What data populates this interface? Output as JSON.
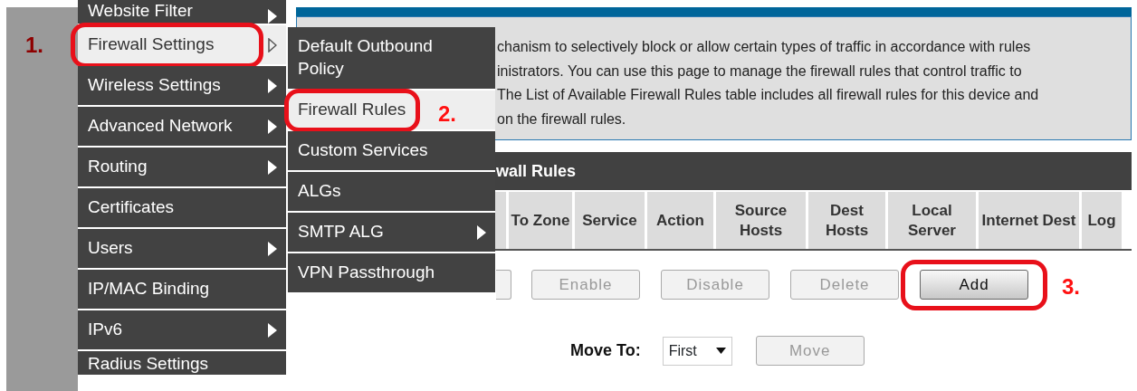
{
  "menu": {
    "items": [
      {
        "label": "Website Filter",
        "submenu": true,
        "selected": false
      },
      {
        "label": "Firewall Settings",
        "submenu": true,
        "selected": true,
        "callout": "1."
      },
      {
        "label": "Wireless Settings",
        "submenu": true,
        "selected": false
      },
      {
        "label": "Advanced Network",
        "submenu": true,
        "selected": false
      },
      {
        "label": "Routing",
        "submenu": true,
        "selected": false
      },
      {
        "label": "Certificates",
        "submenu": false,
        "selected": false
      },
      {
        "label": "Users",
        "submenu": true,
        "selected": false
      },
      {
        "label": "IP/MAC Binding",
        "submenu": false,
        "selected": false
      },
      {
        "label": "IPv6",
        "submenu": true,
        "selected": false
      },
      {
        "label": "Radius Settings",
        "submenu": false,
        "selected": false
      }
    ]
  },
  "submenu": {
    "items": [
      {
        "label": "Default Outbound Policy",
        "submenu": false,
        "selected": false
      },
      {
        "label": "Firewall Rules",
        "submenu": false,
        "selected": true,
        "callout": "2."
      },
      {
        "label": "Custom Services",
        "submenu": false,
        "selected": false
      },
      {
        "label": "ALGs",
        "submenu": false,
        "selected": false
      },
      {
        "label": "SMTP ALG",
        "submenu": true,
        "selected": false
      },
      {
        "label": "VPN Passthrough",
        "submenu": false,
        "selected": false
      }
    ]
  },
  "info": {
    "lines": [
      "chanism to selectively block or allow certain types of traffic in accordance with rules",
      "inistrators. You can use this page to manage the firewall rules that control traffic to",
      "The List of Available Firewall Rules table includes all firewall rules for this device and",
      "on the firewall rules."
    ]
  },
  "table": {
    "title": "wall Rules",
    "columns": [
      "To Zone",
      "Service",
      "Action",
      "Source Hosts",
      "Dest Hosts",
      "Local Server",
      "Internet Dest",
      "Log"
    ]
  },
  "buttons": [
    {
      "label": "Enable",
      "disabled": true
    },
    {
      "label": "Disable",
      "disabled": true
    },
    {
      "label": "Delete",
      "disabled": true
    },
    {
      "label": "Add",
      "disabled": false,
      "callout": "3."
    }
  ],
  "move": {
    "label": "Move To:",
    "value": "First",
    "button": {
      "label": "Move",
      "disabled": true
    }
  }
}
